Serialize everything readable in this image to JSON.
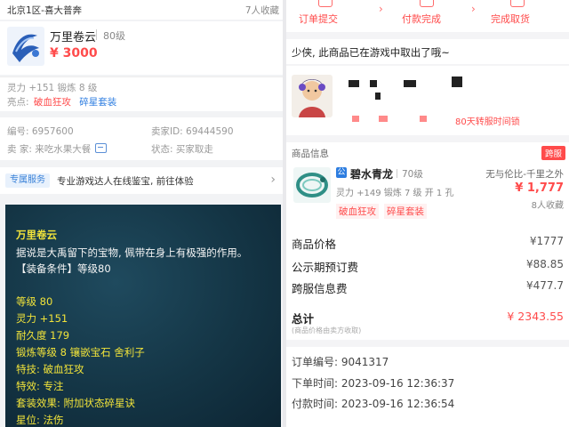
{
  "left": {
    "header": {
      "server": "北京1区-喜大普奔",
      "favorites": "7人收藏"
    },
    "item": {
      "name": "万里卷云",
      "level": "80级",
      "price": "¥ 3000"
    },
    "attributes": {
      "stats": "灵力 +151 锻炼 8 级",
      "tags_label": "亮点:",
      "tag1": "破血狂攻",
      "tag2": "碎星套装"
    },
    "info": {
      "id": "编号: 6957600",
      "seller_id": "卖家ID: 69444590",
      "seller": "卖 家: 来吃水果大餐",
      "status": "状态: 买家取走"
    },
    "service": {
      "badge": "专属服务",
      "text": "专业游戏达人在线鉴宝, 前往体验",
      "arrow": "›"
    },
    "game": {
      "title": "万里卷云",
      "desc": "据说是大禹留下的宝物, 佩带在身上有极强的作用。",
      "req": "【装备条件】等级80",
      "level": "等级 80",
      "spirit": "灵力 +151",
      "durability": "耐久度 179",
      "forge": "锻炼等级 8 镶嵌宝石 舍利子",
      "skill": "特技: 破血狂攻",
      "effect": "特效: 专注",
      "set": "套装效果: 附加状态碎星诀",
      "star": "星位: 法伤"
    }
  },
  "right": {
    "steps": [
      "订单提交",
      "付款完成",
      "完成取货"
    ],
    "step_chevron": "›",
    "notice": "少侠, 此商品已在游戏中取出了哦~",
    "lock_text": "80天转服时间锁",
    "product": {
      "section": "商品信息",
      "cross_badge": "跨服",
      "pay_badge": "公",
      "name": "碧水青龙",
      "level": "70级",
      "server": "无与伦比-千里之外",
      "stats": "灵力 +149 锻炼 7 级 开 1 孔",
      "price": "¥ 1,777",
      "favorites": "8人收藏",
      "tag1": "破血狂攻",
      "tag2": "碎星套装"
    },
    "fees": {
      "price_label": "商品价格",
      "price_value": "¥1777",
      "public_label": "公示期预订费",
      "public_value": "¥88.85",
      "cross_label": "跨服信息费",
      "cross_value": "¥477.7",
      "total_label": "总计",
      "total_value": "¥ 2343.55",
      "total_note": "(商品价格由卖方收取)"
    },
    "order": {
      "number": "订单编号:  9041317",
      "order_time": "下单时间:  2023-09-16 12:36:37",
      "pay_time": "付款时间:  2023-09-16 12:36:54"
    }
  }
}
